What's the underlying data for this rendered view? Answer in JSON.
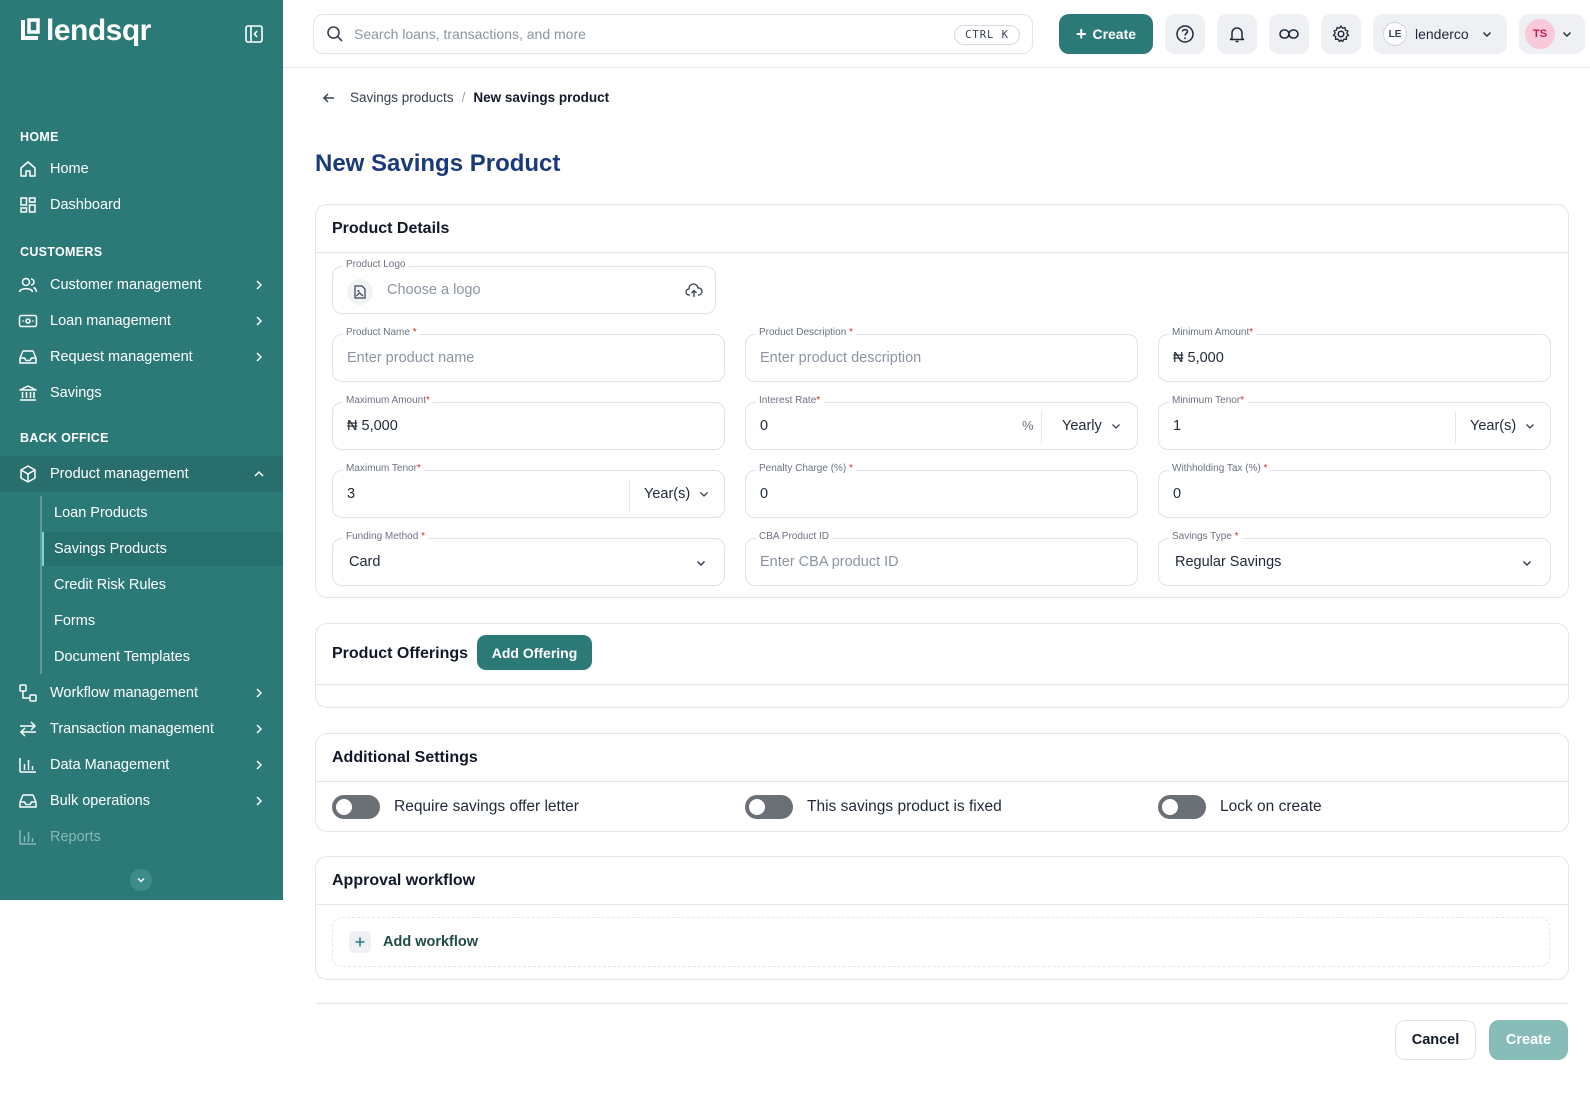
{
  "brand": {
    "name": "lendsqr"
  },
  "search": {
    "placeholder": "Search loans, transactions, and more",
    "shortcut": "CTRL K"
  },
  "topbar": {
    "create_label": "Create",
    "org_initials": "LE",
    "org_name": "lenderco",
    "user_initials": "TS"
  },
  "sidebar": {
    "sections": {
      "home": "HOME",
      "customers": "CUSTOMERS",
      "back_office": "BACK OFFICE"
    },
    "home": {
      "label": "Home"
    },
    "dashboard": {
      "label": "Dashboard"
    },
    "customer_management": {
      "label": "Customer management"
    },
    "loan_management": {
      "label": "Loan management"
    },
    "request_management": {
      "label": "Request management"
    },
    "savings": {
      "label": "Savings"
    },
    "product_management": {
      "label": "Product management"
    },
    "product_sub": {
      "loan_products": "Loan Products",
      "savings_products": "Savings Products",
      "credit_risk_rules": "Credit Risk Rules",
      "forms": "Forms",
      "document_templates": "Document Templates"
    },
    "workflow_management": {
      "label": "Workflow management"
    },
    "transaction_management": {
      "label": "Transaction management"
    },
    "data_management": {
      "label": "Data Management"
    },
    "bulk_operations": {
      "label": "Bulk operations"
    },
    "reports": {
      "label": "Reports"
    }
  },
  "breadcrumb": {
    "parent": "Savings products",
    "separator": "/",
    "current": "New savings product"
  },
  "page": {
    "title": "New Savings Product"
  },
  "product_details": {
    "heading": "Product Details",
    "logo": {
      "label": "Product Logo",
      "placeholder": "Choose a logo"
    },
    "product_name": {
      "label": "Product Name",
      "placeholder": "Enter product name"
    },
    "product_description": {
      "label": "Product Description",
      "placeholder": "Enter product description"
    },
    "minimum_amount": {
      "label": "Minimum Amount",
      "currency": "₦",
      "value": "5,000"
    },
    "maximum_amount": {
      "label": "Maximum Amount",
      "currency": "₦",
      "value": "5,000"
    },
    "interest_rate": {
      "label": "Interest Rate",
      "value": "0",
      "suffix": "%",
      "period": "Yearly"
    },
    "minimum_tenor": {
      "label": "Minimum Tenor",
      "value": "1",
      "unit": "Year(s)"
    },
    "maximum_tenor": {
      "label": "Maximum Tenor",
      "value": "3",
      "unit": "Year(s)"
    },
    "penalty_charge": {
      "label": "Penalty Charge (%)",
      "value": "0"
    },
    "withholding_tax": {
      "label": "Withholding Tax (%)",
      "value": "0"
    },
    "funding_method": {
      "label": "Funding Method",
      "value": "Card"
    },
    "cba_product_id": {
      "label": "CBA Product ID",
      "placeholder": "Enter CBA product ID"
    },
    "savings_type": {
      "label": "Savings Type",
      "value": "Regular Savings"
    },
    "required_marker": "*"
  },
  "offerings": {
    "heading": "Product Offerings",
    "add_label": "Add Offering"
  },
  "additional_settings": {
    "heading": "Additional Settings",
    "toggles": [
      {
        "label": "Require savings offer letter",
        "on": false
      },
      {
        "label": "This savings product is fixed",
        "on": false
      },
      {
        "label": "Lock on create",
        "on": false
      }
    ]
  },
  "approval_workflow": {
    "heading": "Approval workflow",
    "add_label": "Add workflow"
  },
  "footer": {
    "cancel_label": "Cancel",
    "create_label": "Create"
  },
  "colors": {
    "brand": "#2b7a78",
    "title": "#1a3a7a",
    "required": "#dc2626",
    "create_disabled": "#88bcb8"
  }
}
